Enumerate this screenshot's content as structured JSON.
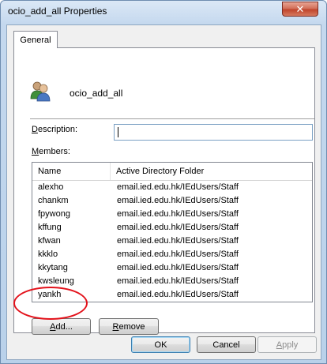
{
  "window": {
    "title": "ocio_add_all Properties",
    "close_label": "✕"
  },
  "tabs": [
    {
      "label": "General",
      "selected": true
    }
  ],
  "general": {
    "group_icon": "users-group-icon",
    "group_name": "ocio_add_all",
    "description": {
      "label_prefix": "",
      "label_accel": "D",
      "label_rest": "escription:",
      "value": ""
    },
    "members": {
      "label_accel": "M",
      "label_rest": "embers:",
      "columns": [
        "Name",
        "Active Directory Folder"
      ],
      "rows": [
        {
          "name": "alexho",
          "folder": "email.ied.edu.hk/IEdUsers/Staff"
        },
        {
          "name": "chankm",
          "folder": "email.ied.edu.hk/IEdUsers/Staff"
        },
        {
          "name": "fpywong",
          "folder": "email.ied.edu.hk/IEdUsers/Staff"
        },
        {
          "name": "kffung",
          "folder": "email.ied.edu.hk/IEdUsers/Staff"
        },
        {
          "name": "kfwan",
          "folder": "email.ied.edu.hk/IEdUsers/Staff"
        },
        {
          "name": "kkklo",
          "folder": "email.ied.edu.hk/IEdUsers/Staff"
        },
        {
          "name": "kkytang",
          "folder": "email.ied.edu.hk/IEdUsers/Staff"
        },
        {
          "name": "kwsleung",
          "folder": "email.ied.edu.hk/IEdUsers/Staff"
        },
        {
          "name": "yankh",
          "folder": "email.ied.edu.hk/IEdUsers/Staff"
        }
      ]
    },
    "add_button": {
      "accel": "A",
      "rest": "dd..."
    },
    "remove_button": {
      "accel": "R",
      "rest": "emove"
    }
  },
  "footer": {
    "ok_label": "OK",
    "cancel_label": "Cancel",
    "apply_button": {
      "accel": "A",
      "rest": "pply",
      "enabled": false
    }
  },
  "annotation": {
    "shape": "ellipse",
    "color": "#e3121b",
    "target": "add-button"
  },
  "colors": {
    "title_bar": "#c4d8ee",
    "close_button": "#c0452c",
    "dialog_background": "#f0f0f0",
    "default_button_border": "#3c7fb1"
  }
}
